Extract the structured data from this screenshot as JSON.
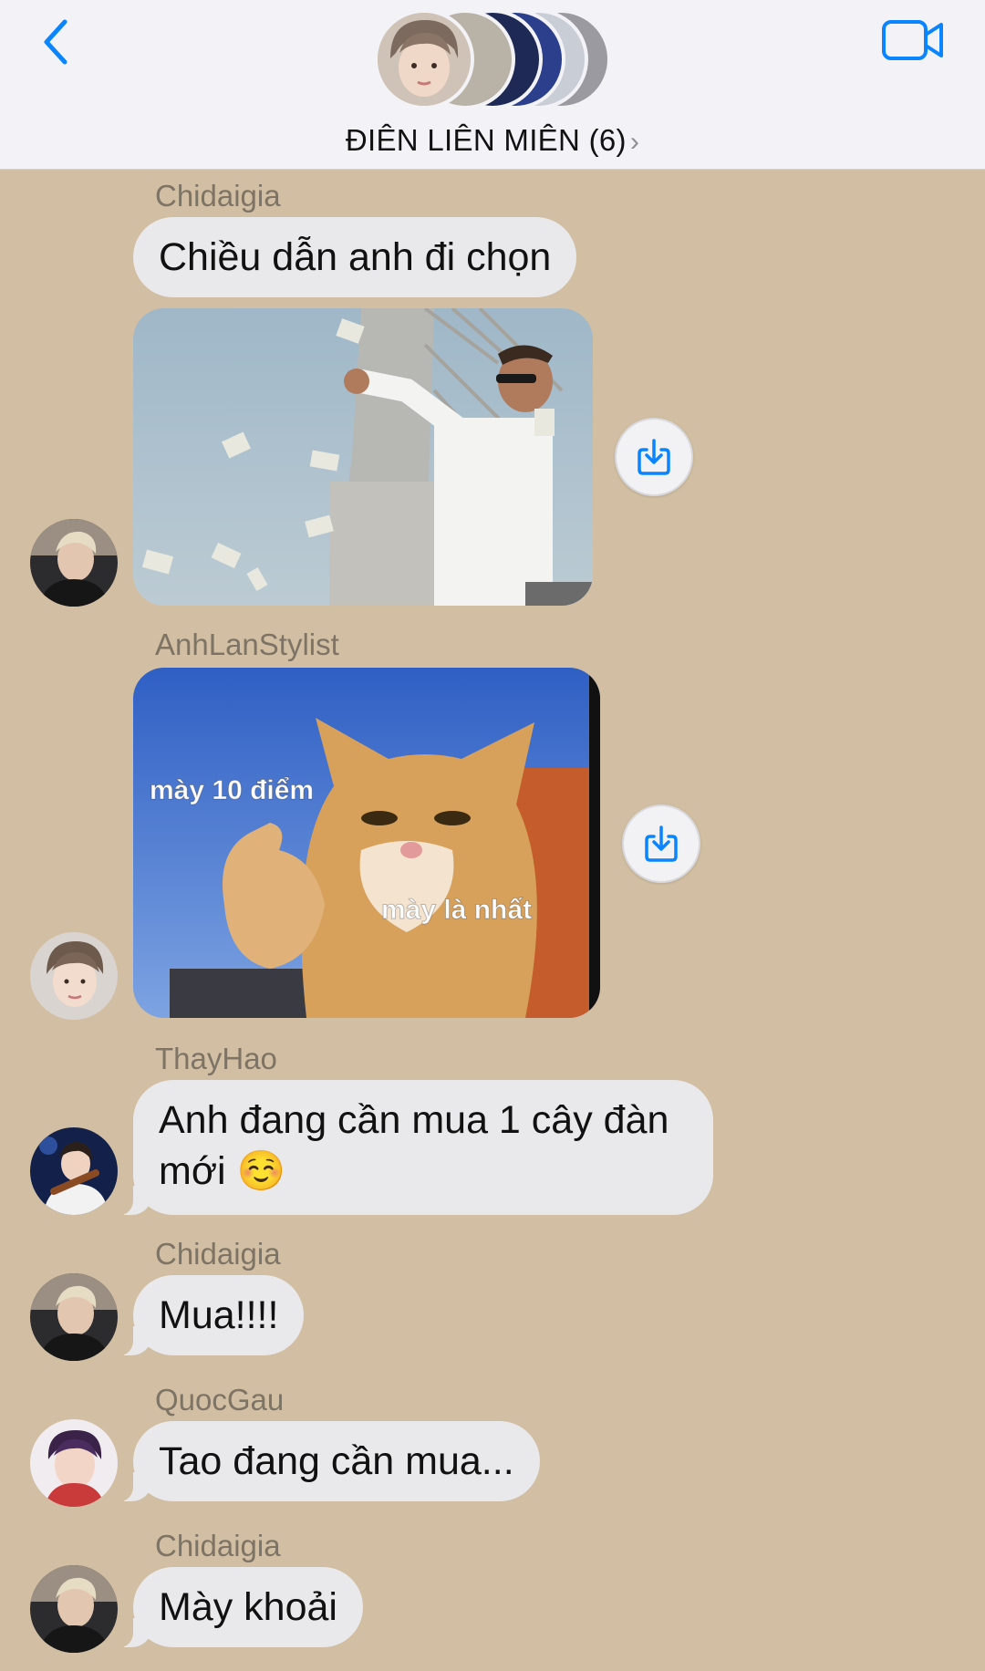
{
  "header": {
    "title": "ĐIÊN LIÊN MIÊN (6)",
    "member_avatar_count": 6
  },
  "messages": [
    {
      "sender": "Chidaigia",
      "text": "Chiều dẫn anh đi chọn"
    },
    {
      "sender": "Chidaigia",
      "image": "money-throw-meme"
    },
    {
      "sender": "AnhLanStylist",
      "image": "cat-thumbs-up-meme",
      "caption_top": "mày 10 điểm",
      "caption_bottom": "mày là nhất"
    },
    {
      "sender": "ThayHao",
      "text_line1": "Anh đang cần mua 1 cây đàn",
      "text_line2": "mới ☺️"
    },
    {
      "sender": "Chidaigia",
      "text": "Mua!!!!"
    },
    {
      "sender": "QuocGau",
      "text": "Tao đang cần mua..."
    },
    {
      "sender": "Chidaigia",
      "text": "Mày khoải"
    }
  ],
  "colors": {
    "accent": "#0a84ff",
    "chat_background": "#d2bfa3",
    "bubble": "#e9e9eb",
    "header": "#f3f2f7"
  }
}
